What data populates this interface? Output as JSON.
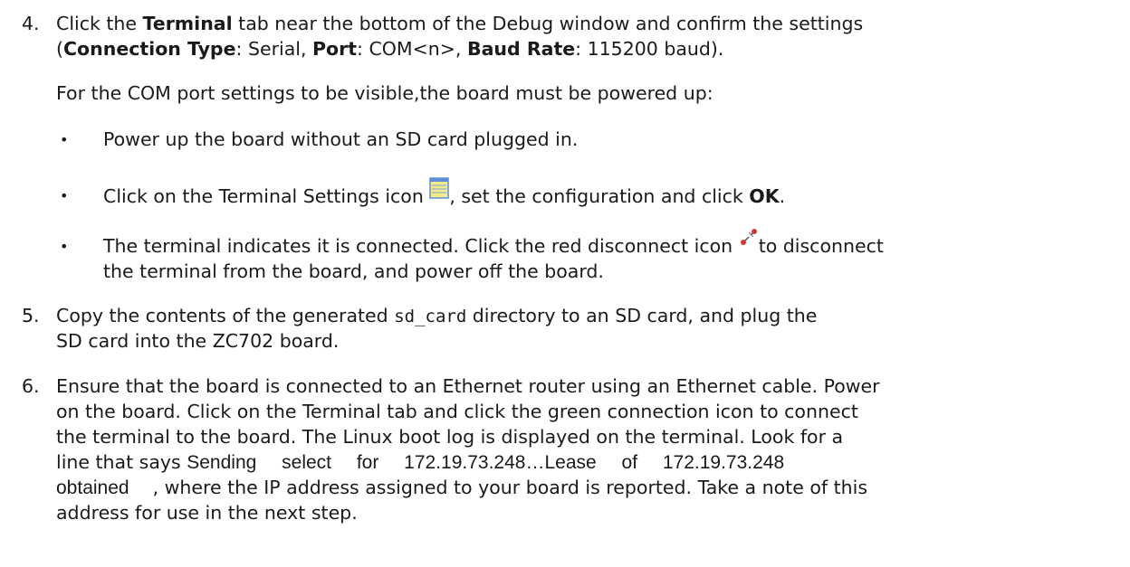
{
  "step4": {
    "number": "4.",
    "line1": {
      "t1": "Click the ",
      "b1": "Terminal",
      "t2": " tab near the bottom of the Debug window and confirm the settings"
    },
    "line2": {
      "t1": "(",
      "b1": "Connection Type",
      "t2": ": Serial, ",
      "b2": "Port",
      "t3": ": COM<n>, ",
      "b3": "Baud Rate",
      "t4": ": 115200 baud)."
    },
    "intro": "For the COM port settings to be visible,the board must be powered up:",
    "bullet_glyph": "•",
    "bullet1": "Power up the board without an SD card plugged in.",
    "bullet2": {
      "t1": "Click on the Terminal Settings icon ",
      "t2": ", set the configuration and click ",
      "b1": "OK",
      "t3": "."
    },
    "bullet3": {
      "line1_t1": "The terminal indicates it is connected. Click the red disconnect icon ",
      "line1_t2": "to disconnect",
      "line2": "the terminal from the board, and power off the board."
    }
  },
  "step5": {
    "number": "5.",
    "line1": {
      "t1": "Copy the contents of the generated ",
      "code": "sd_card",
      "t2": " directory to an SD card, and plug the"
    },
    "line2": "SD card into the ZC702 board."
  },
  "step6": {
    "number": "6.",
    "line1": "Ensure that the board is connected to an Ethernet router using an Ethernet cable. Power",
    "line2": "on the board. Click on the Terminal tab and click the green connection icon to connect",
    "line3": "the terminal to the board. The Linux boot log is displayed on the terminal. Look for a",
    "line4": {
      "t1": "line that says ",
      "log": "Sending select for 172.19.73.248…Lease of 172.19.73.248"
    },
    "line5": {
      "log": "obtained",
      "t1": ", where the IP address assigned to your board is reported. Take a note of this"
    },
    "line6": "address for use in the next step."
  },
  "icons": {
    "terminal_settings": "terminal-settings-icon",
    "disconnect": "disconnect-icon"
  },
  "colors": {
    "text": "#1a1a1a",
    "terminal_icon_fill": "#f5e98a",
    "terminal_icon_border": "#5b8fd6",
    "disconnect_red": "#d23a2e"
  }
}
